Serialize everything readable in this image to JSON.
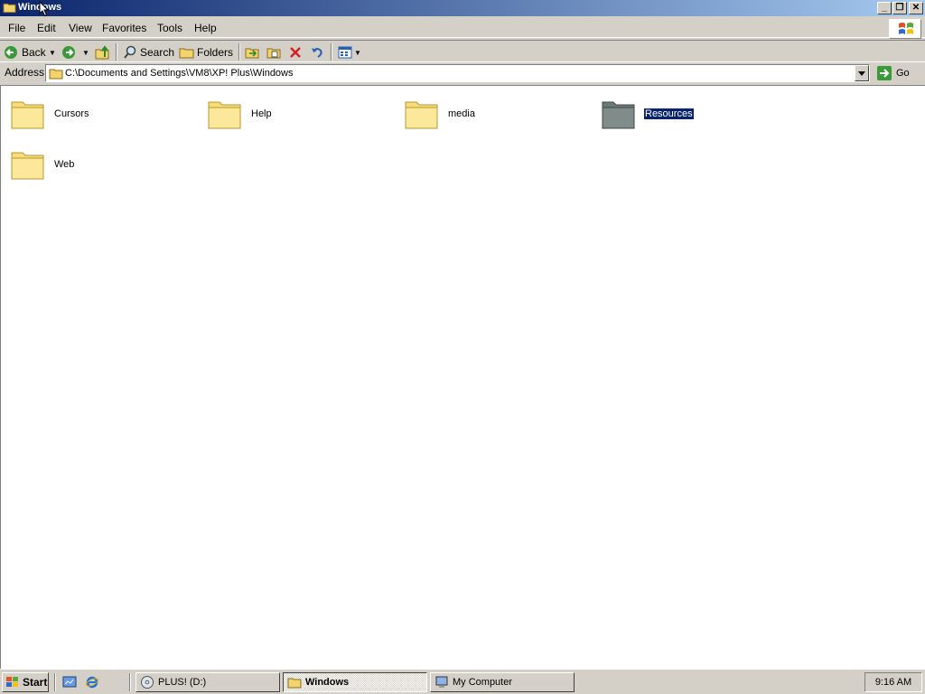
{
  "window": {
    "title": "Windows"
  },
  "menu": [
    "File",
    "Edit",
    "View",
    "Favorites",
    "Tools",
    "Help"
  ],
  "toolbar": {
    "back_label": "Back",
    "search_label": "Search",
    "folders_label": "Folders"
  },
  "address": {
    "label": "Address",
    "path": "C:\\Documents and Settings\\VM8\\XP! Plus\\Windows",
    "go_label": "Go"
  },
  "folders": [
    {
      "name": "Cursors",
      "selected": false
    },
    {
      "name": "Help",
      "selected": false
    },
    {
      "name": "media",
      "selected": false
    },
    {
      "name": "Resources",
      "selected": true
    },
    {
      "name": "Web",
      "selected": false
    }
  ],
  "taskbar": {
    "start_label": "Start",
    "tasks": [
      {
        "label": "PLUS! (D:)",
        "active": false
      },
      {
        "label": "Windows",
        "active": true
      },
      {
        "label": "My Computer",
        "active": false
      }
    ],
    "clock": "9:16 AM"
  }
}
